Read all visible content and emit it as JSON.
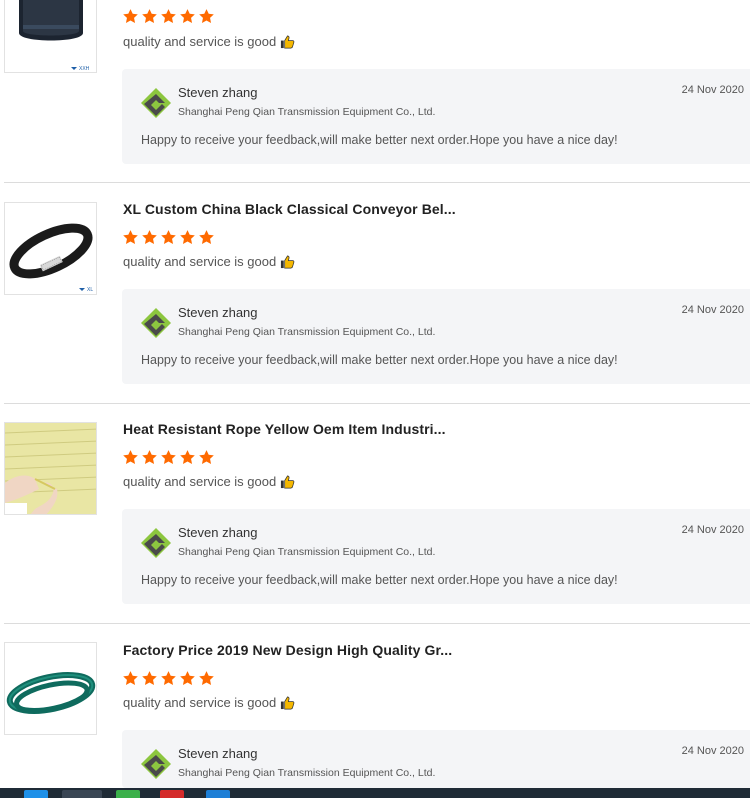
{
  "reviews": [
    {
      "title": "",
      "rating": 5,
      "comment": "quality and service is good",
      "image_icon": "black-timing-belt-image",
      "image_tag": "XXH",
      "reply": {
        "name": "Steven zhang",
        "company": "Shanghai Peng Qian Transmission Equipment Co., Ltd.",
        "date": "24 Nov 2020",
        "message": "Happy to receive your feedback,will make better next order.Hope you have a nice day!"
      }
    },
    {
      "title": "XL Custom China Black Classical Conveyor Bel...",
      "rating": 5,
      "comment": "quality and service is good",
      "image_icon": "black-conveyor-belt-image",
      "image_tag": "XL",
      "reply": {
        "name": "Steven zhang",
        "company": "Shanghai Peng Qian Transmission Equipment Co., Ltd.",
        "date": "24 Nov 2020",
        "message": "Happy to receive your feedback,will make better next order.Hope you have a nice day!"
      }
    },
    {
      "title": "Heat Resistant Rope Yellow Oem Item Industri...",
      "rating": 5,
      "comment": "quality and service is good",
      "image_icon": "yellow-rope-image",
      "image_tag": "",
      "reply": {
        "name": "Steven zhang",
        "company": "Shanghai Peng Qian Transmission Equipment Co., Ltd.",
        "date": "24 Nov 2020",
        "message": "Happy to receive your feedback,will make better next order.Hope you have a nice day!"
      }
    },
    {
      "title": "Factory Price 2019 New Design High Quality Gr...",
      "rating": 5,
      "comment": "quality and service is good",
      "image_icon": "green-flat-belt-image",
      "image_tag": "",
      "reply": {
        "name": "Steven zhang",
        "company": "Shanghai Peng Qian Transmission Equipment Co., Ltd.",
        "date": "24 Nov 2020",
        "message": ""
      }
    }
  ],
  "colors": {
    "star": "#ff6a00",
    "reply_bg": "#f4f5f7",
    "logo_green": "#8cc63f",
    "logo_dark": "#4a4a4a",
    "taskbar": "#1f2b36"
  },
  "taskbar": {
    "icons": [
      "windows-start-icon",
      "search-icon",
      "chrome-icon",
      "app-red-icon",
      "app-blue-icon"
    ]
  }
}
